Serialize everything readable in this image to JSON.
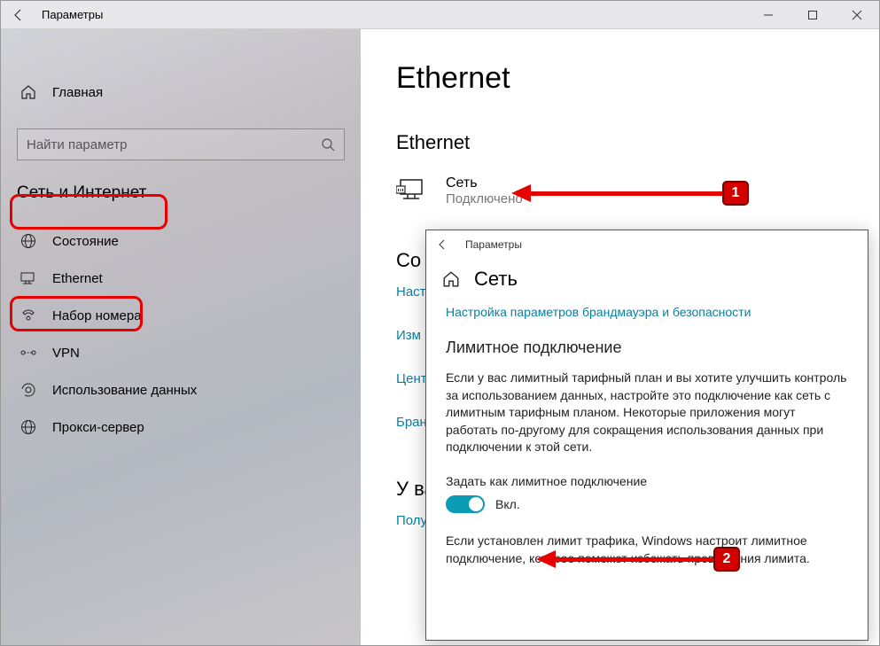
{
  "titlebar": {
    "title": "Параметры"
  },
  "sidebar": {
    "home": "Главная",
    "search_placeholder": "Найти параметр",
    "group": "Сеть и Интернет",
    "items": [
      {
        "label": "Состояние"
      },
      {
        "label": "Ethernet"
      },
      {
        "label": "Набор номера"
      },
      {
        "label": "VPN"
      },
      {
        "label": "Использование данных"
      },
      {
        "label": "Прокси-сервер"
      }
    ]
  },
  "main": {
    "h1": "Ethernet",
    "h2": "Ethernet",
    "network": {
      "name": "Сеть",
      "status": "Подключено"
    },
    "related_h": "Со",
    "links": [
      "Наст",
      "Изм",
      "Цент",
      "Бран"
    ],
    "question_h": "У ва",
    "question_link": "Полу"
  },
  "overlay": {
    "title": "Параметры",
    "header": "Сеть",
    "firewall_link": "Настройка параметров брандмауэра и безопасности",
    "metered_h": "Лимитное подключение",
    "metered_p": "Если у вас лимитный тарифный план и вы хотите улучшить контроль за использованием данных, настройте это подключение как сеть с лимитным тарифным планом. Некоторые приложения могут работать по-другому для сокращения использования данных при подключении к этой сети.",
    "toggle_label": "Задать как лимитное подключение",
    "toggle_state": "Вкл.",
    "limit_p": "Если установлен лимит трафика, Windows настроит лимитное подключение, которое поможет избежать превышения лимита."
  },
  "callouts": {
    "c1": "1",
    "c2": "2"
  }
}
